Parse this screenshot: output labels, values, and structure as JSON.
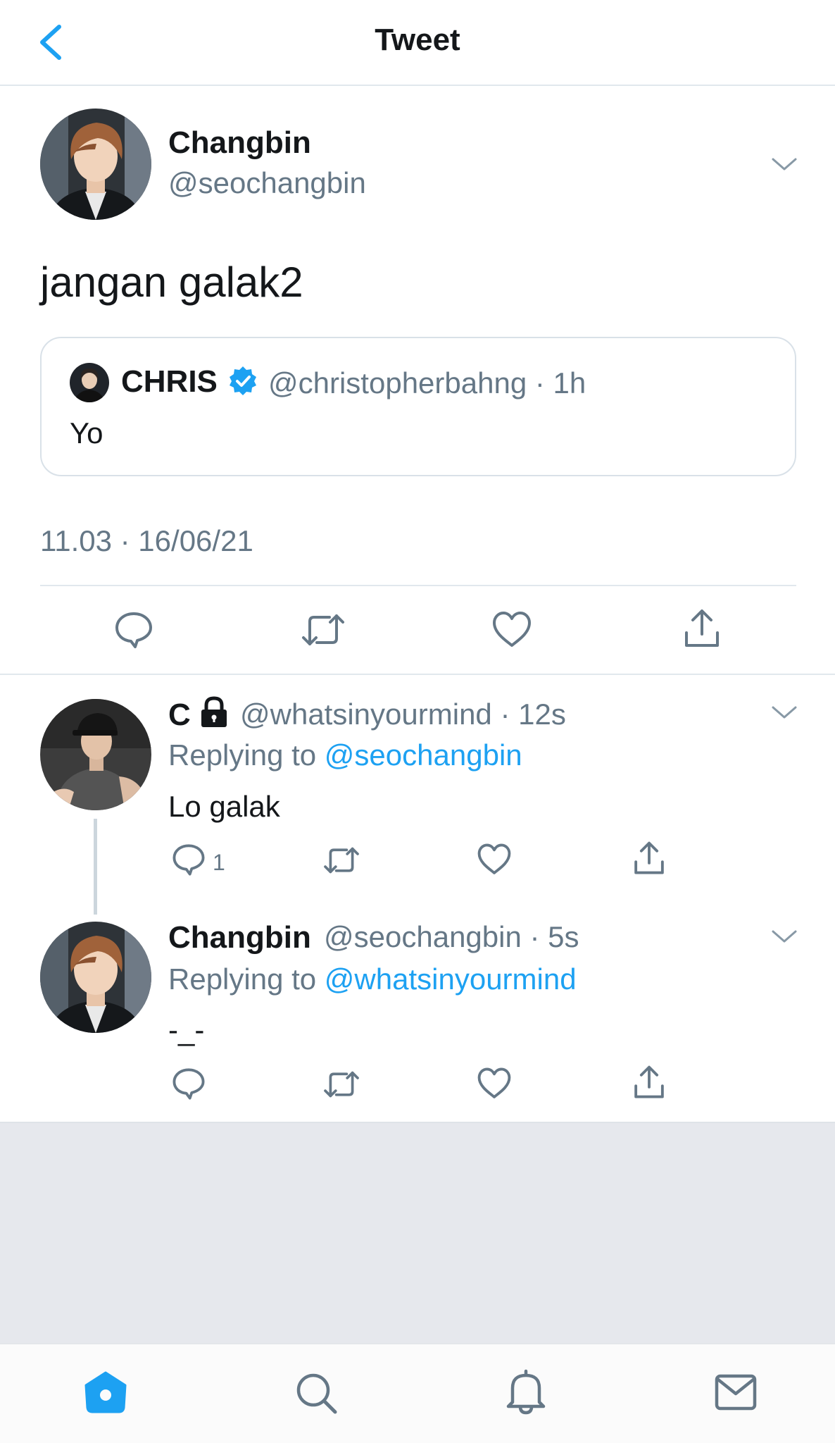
{
  "header": {
    "title": "Tweet"
  },
  "main_tweet": {
    "name": "Changbin",
    "handle": "@seochangbin",
    "text": "jangan galak2",
    "quote": {
      "name": "CHRIS",
      "meta": "@christopherbahng · 1h",
      "text": "Yo"
    },
    "timestamp": "11.03 · 16/06/21"
  },
  "replies": [
    {
      "name": "C",
      "meta": "@whatsinyourmind · 12s",
      "replying_prefix": "Replying to ",
      "replying_to": "@seochangbin",
      "text": "Lo galak",
      "reply_count": "1"
    },
    {
      "name": "Changbin",
      "meta": "@seochangbin · 5s",
      "replying_prefix": "Replying to ",
      "replying_to": "@whatsinyourmind",
      "text": "-_-"
    }
  ],
  "icons": {
    "back": "chevron-left-icon",
    "more": "chevron-down-icon",
    "reply": "reply-bubble-icon",
    "retweet": "retweet-icon",
    "like": "heart-icon",
    "share": "share-icon",
    "verified": "verified-badge-icon",
    "lock": "lock-icon",
    "tabs": [
      "home-icon",
      "search-icon",
      "bell-icon",
      "mail-icon"
    ]
  },
  "colors": {
    "accent": "#1da1f2",
    "text": "#14171a",
    "muted": "#657786",
    "divider": "#e1e8ed",
    "empty_area": "#e6e8ed",
    "tabbar": "#fbfbfb"
  }
}
